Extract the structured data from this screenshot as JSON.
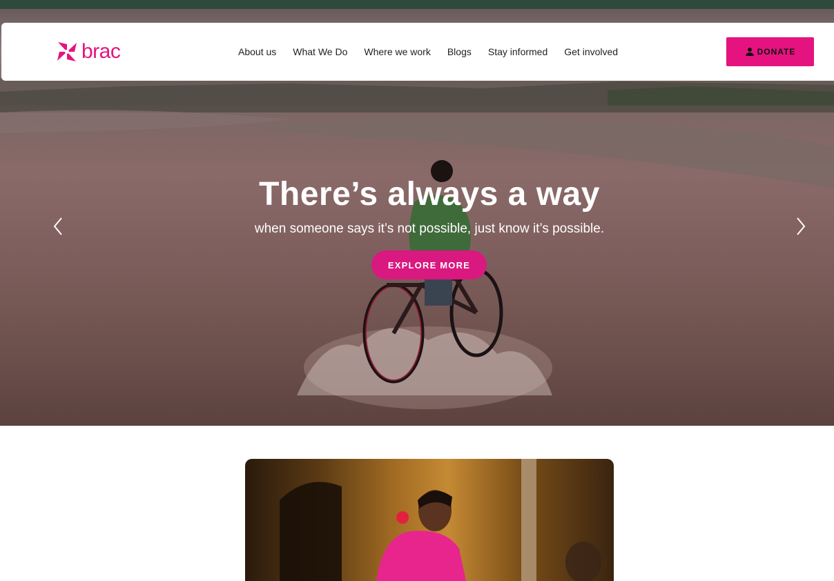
{
  "brand": {
    "name": "brac",
    "color": "#e5137f"
  },
  "nav": {
    "items": [
      {
        "label": "About us"
      },
      {
        "label": "What We Do"
      },
      {
        "label": "Where we work"
      },
      {
        "label": "Blogs"
      },
      {
        "label": "Stay informed"
      },
      {
        "label": "Get involved"
      }
    ]
  },
  "donate": {
    "label": "DONATE",
    "icon": "hand-heart-icon"
  },
  "hero": {
    "title": "There’s always a way",
    "subtitle": "when someone says it’s not possible, just know it’s possible.",
    "cta": "EXPLORE MORE",
    "prev_icon": "chevron-left-icon",
    "next_icon": "chevron-right-icon"
  },
  "colors": {
    "topbar": "#2e4a3c",
    "accent": "#e5137f",
    "cta": "#d9197f"
  }
}
